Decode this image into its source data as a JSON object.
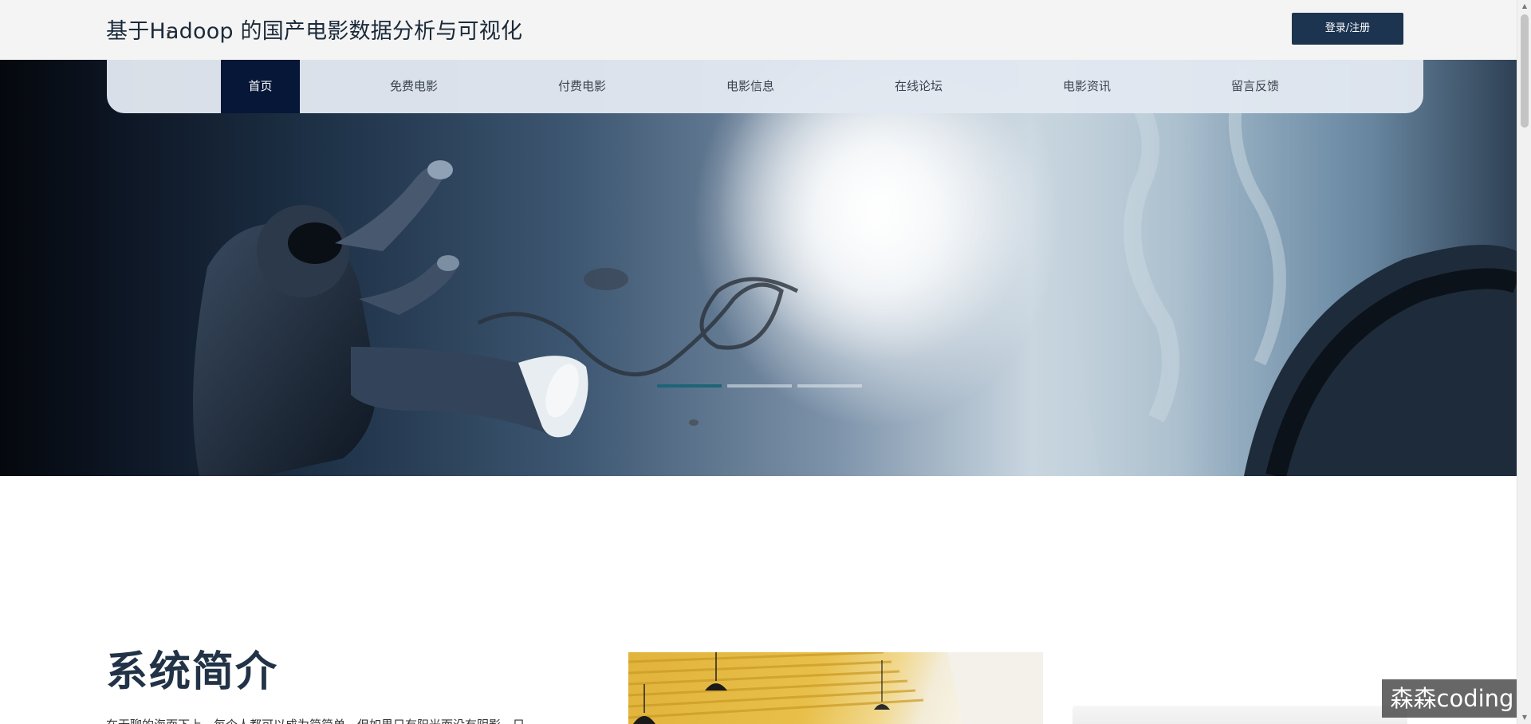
{
  "header": {
    "site_title": "基于Hadoop 的国产电影数据分析与可视化",
    "login_label": "登录/注册"
  },
  "nav": {
    "items": [
      {
        "label": "首页",
        "active": true
      },
      {
        "label": "免费电影",
        "active": false
      },
      {
        "label": "付费电影",
        "active": false
      },
      {
        "label": "电影信息",
        "active": false
      },
      {
        "label": "在线论坛",
        "active": false
      },
      {
        "label": "电影资讯",
        "active": false
      },
      {
        "label": "留言反馈",
        "active": false
      }
    ]
  },
  "carousel": {
    "slide_count": 3,
    "active_index": 0
  },
  "intro": {
    "title": "系统简介",
    "text_fragment": "在无聊的海面下上，每个人都可以成为简简单，但如果只有阳光而没有阴影，只"
  },
  "watermark": {
    "text": "森森coding"
  },
  "colors": {
    "header_bg": "#f4f4f4",
    "nav_active_bg": "#061738",
    "login_button_bg": "#1c3450",
    "indicator_active": "#1d6477",
    "title_color": "#223347"
  }
}
